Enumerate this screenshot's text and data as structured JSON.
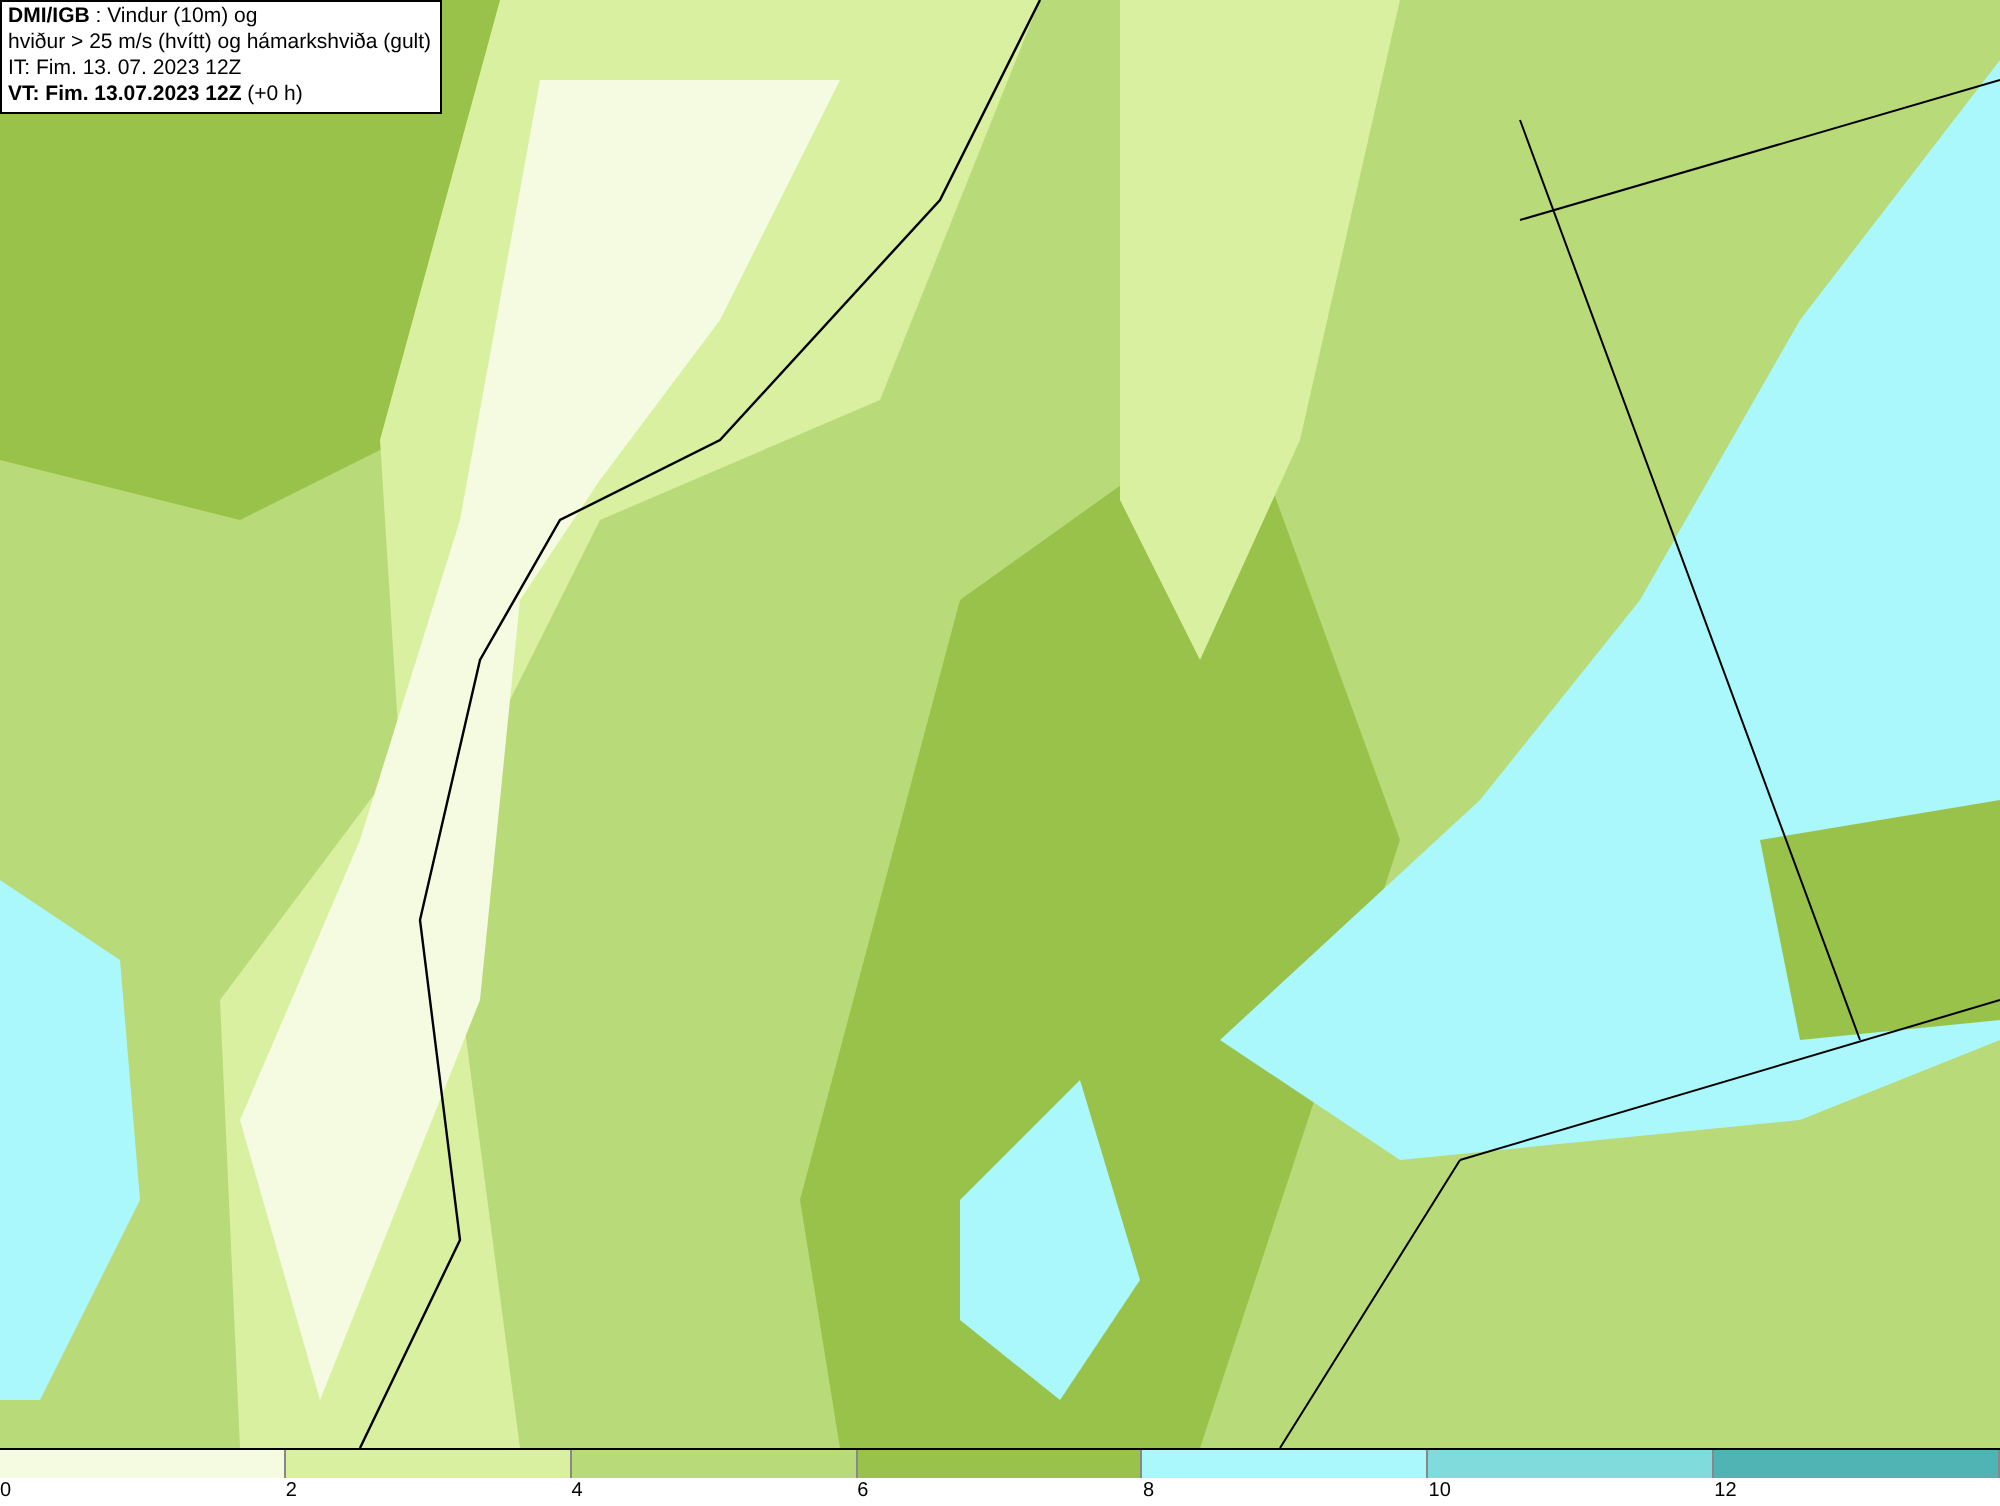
{
  "info_box": {
    "lines": [
      "**DMI/IGB** : Vindur (10m) og",
      "hviður > 25 m/s (hvítt) og hámarkshviða (gult)",
      "IT: Fim. 13. 07. 2023 12Z",
      "**VT: Fim. 13.07.2023 12Z** (+0 h)"
    ]
  },
  "legend": {
    "bins": [
      {
        "color": "#f5fbe0"
      },
      {
        "color": "#d8f0a0"
      },
      {
        "color": "#b8da78"
      },
      {
        "color": "#98c24a"
      },
      {
        "color": "#aaf8fc"
      },
      {
        "color": "#80dcdc"
      },
      {
        "color": "#50b4b4"
      }
    ],
    "ticks": [
      "0",
      "2",
      "4",
      "6",
      "8",
      "10",
      "12"
    ]
  }
}
